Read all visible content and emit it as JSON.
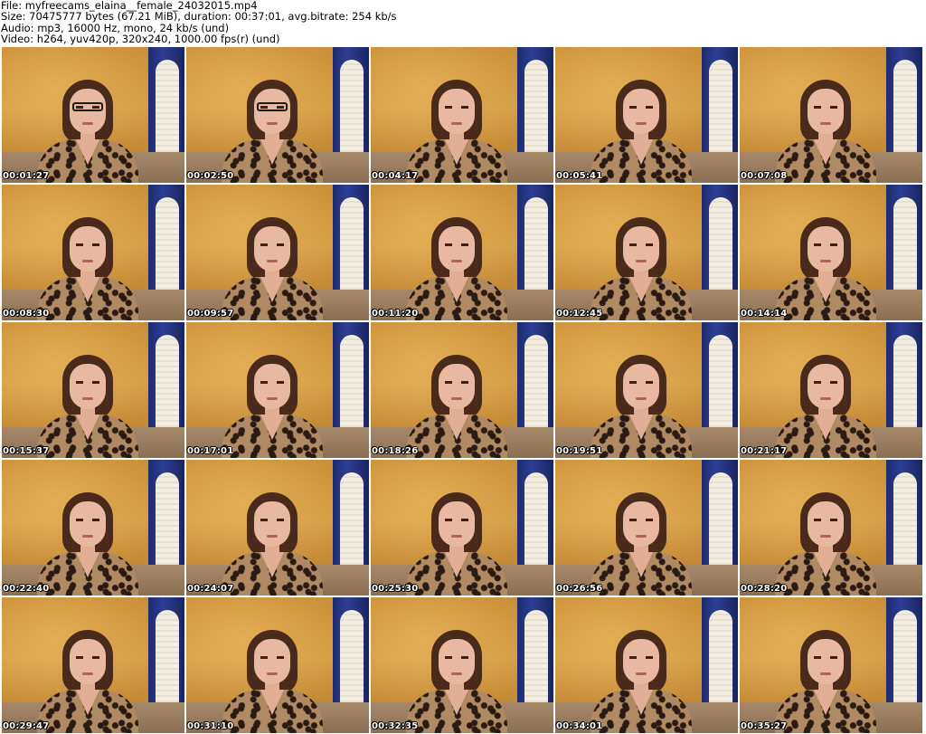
{
  "header": {
    "file_line": "File: myfreecams_elaina__female_24032015.mp4",
    "size_line": "Size: 70475777 bytes (67.21 MiB), duration: 00:37:01, avg.bitrate: 254 kb/s",
    "audio_line": "Audio: mp3, 16000 Hz, mono, 24 kb/s (und)",
    "video_line": "Video: h264, yuv420p, 320x240, 1000.00 fps(r) (und)"
  },
  "thumbnails": [
    {
      "timestamp": "00:01:27",
      "glasses": true
    },
    {
      "timestamp": "00:02:50",
      "glasses": true
    },
    {
      "timestamp": "00:04:17",
      "glasses": false
    },
    {
      "timestamp": "00:05:41",
      "glasses": false
    },
    {
      "timestamp": "00:07:08",
      "glasses": false
    },
    {
      "timestamp": "00:08:30",
      "glasses": false
    },
    {
      "timestamp": "00:09:57",
      "glasses": false
    },
    {
      "timestamp": "00:11:20",
      "glasses": false
    },
    {
      "timestamp": "00:12:45",
      "glasses": false
    },
    {
      "timestamp": "00:14:14",
      "glasses": false
    },
    {
      "timestamp": "00:15:37",
      "glasses": false
    },
    {
      "timestamp": "00:17:01",
      "glasses": false
    },
    {
      "timestamp": "00:18:26",
      "glasses": false
    },
    {
      "timestamp": "00:19:51",
      "glasses": false
    },
    {
      "timestamp": "00:21:17",
      "glasses": false
    },
    {
      "timestamp": "00:22:40",
      "glasses": false
    },
    {
      "timestamp": "00:24:07",
      "glasses": false
    },
    {
      "timestamp": "00:25:30",
      "glasses": false
    },
    {
      "timestamp": "00:26:56",
      "glasses": false
    },
    {
      "timestamp": "00:28:20",
      "glasses": false
    },
    {
      "timestamp": "00:29:47",
      "glasses": false
    },
    {
      "timestamp": "00:31:10",
      "glasses": false
    },
    {
      "timestamp": "00:32:35",
      "glasses": false
    },
    {
      "timestamp": "00:34:01",
      "glasses": false
    },
    {
      "timestamp": "00:35:27",
      "glasses": false
    }
  ]
}
